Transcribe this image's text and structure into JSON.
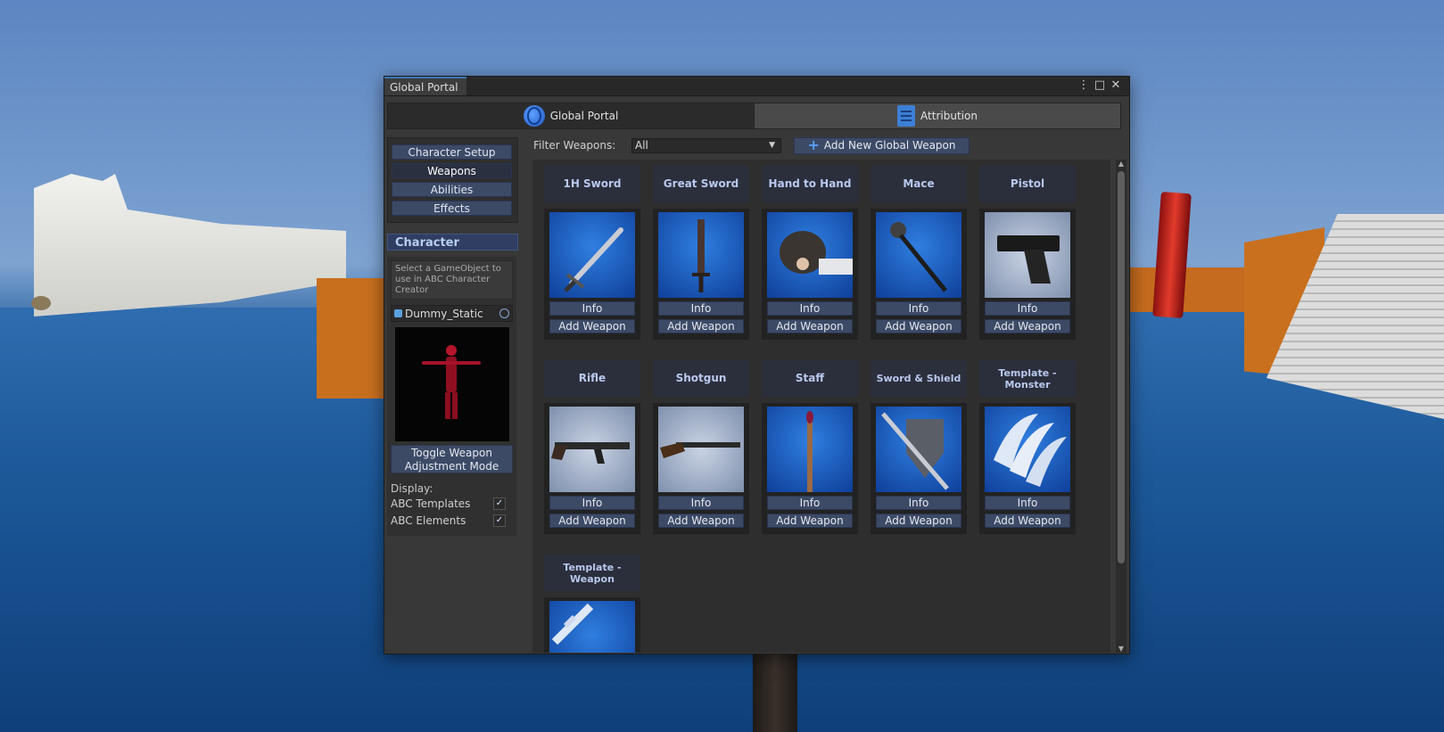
{
  "window": {
    "title": "Global Portal",
    "controls": [
      "⋮",
      "□",
      "✕"
    ]
  },
  "top_tabs": [
    {
      "label": "Global Portal",
      "icon": "globe-icon",
      "active": true
    },
    {
      "label": "Attribution",
      "icon": "document-edit-icon",
      "active": false
    }
  ],
  "sidebar": {
    "nav": [
      {
        "label": "Character Setup",
        "selected": false
      },
      {
        "label": "Weapons",
        "selected": true
      },
      {
        "label": "Abilities",
        "selected": false
      },
      {
        "label": "Effects",
        "selected": false
      }
    ],
    "character_header": "Character",
    "hint": "Select a GameObject to use in ABC Character Creator",
    "object_name": "Dummy_Static",
    "toggle_label": "Toggle Weapon Adjustment Mode",
    "display_label": "Display:",
    "checks": [
      {
        "label": "ABC Templates",
        "checked": true
      },
      {
        "label": "ABC Elements",
        "checked": true
      }
    ]
  },
  "filter": {
    "label": "Filter Weapons:",
    "value": "All",
    "add_new_label": "Add New Global Weapon"
  },
  "weapons": [
    {
      "category": "1H Sword",
      "image": "sword-icon",
      "info": "Info",
      "add": "Add Weapon"
    },
    {
      "category": "Great Sword",
      "image": "great-sword-icon",
      "info": "Info",
      "add": "Add Weapon"
    },
    {
      "category": "Hand to Hand",
      "image": "fist-icon",
      "info": "Info",
      "add": "Add Weapon"
    },
    {
      "category": "Mace",
      "image": "mace-icon",
      "info": "Info",
      "add": "Add Weapon"
    },
    {
      "category": "Pistol",
      "image": "pistol-icon",
      "info": "Info",
      "add": "Add Weapon"
    },
    {
      "category": "Rifle",
      "image": "rifle-icon",
      "info": "Info",
      "add": "Add Weapon"
    },
    {
      "category": "Shotgun",
      "image": "shotgun-icon",
      "info": "Info",
      "add": "Add Weapon"
    },
    {
      "category": "Staff",
      "image": "staff-icon",
      "info": "Info",
      "add": "Add Weapon"
    },
    {
      "category": "Sword & Shield",
      "image": "sword-shield-icon",
      "info": "Info",
      "add": "Add Weapon"
    },
    {
      "category": "Template - Monster",
      "image": "claw-template-icon",
      "info": "Info",
      "add": "Add Weapon"
    },
    {
      "category": "Template - Weapon",
      "image": "sword-template-icon",
      "info": "",
      "add": ""
    }
  ],
  "colors": {
    "accent": "#3a79bb",
    "button": "#3c4a66",
    "header_text": "#b9c8ee"
  }
}
